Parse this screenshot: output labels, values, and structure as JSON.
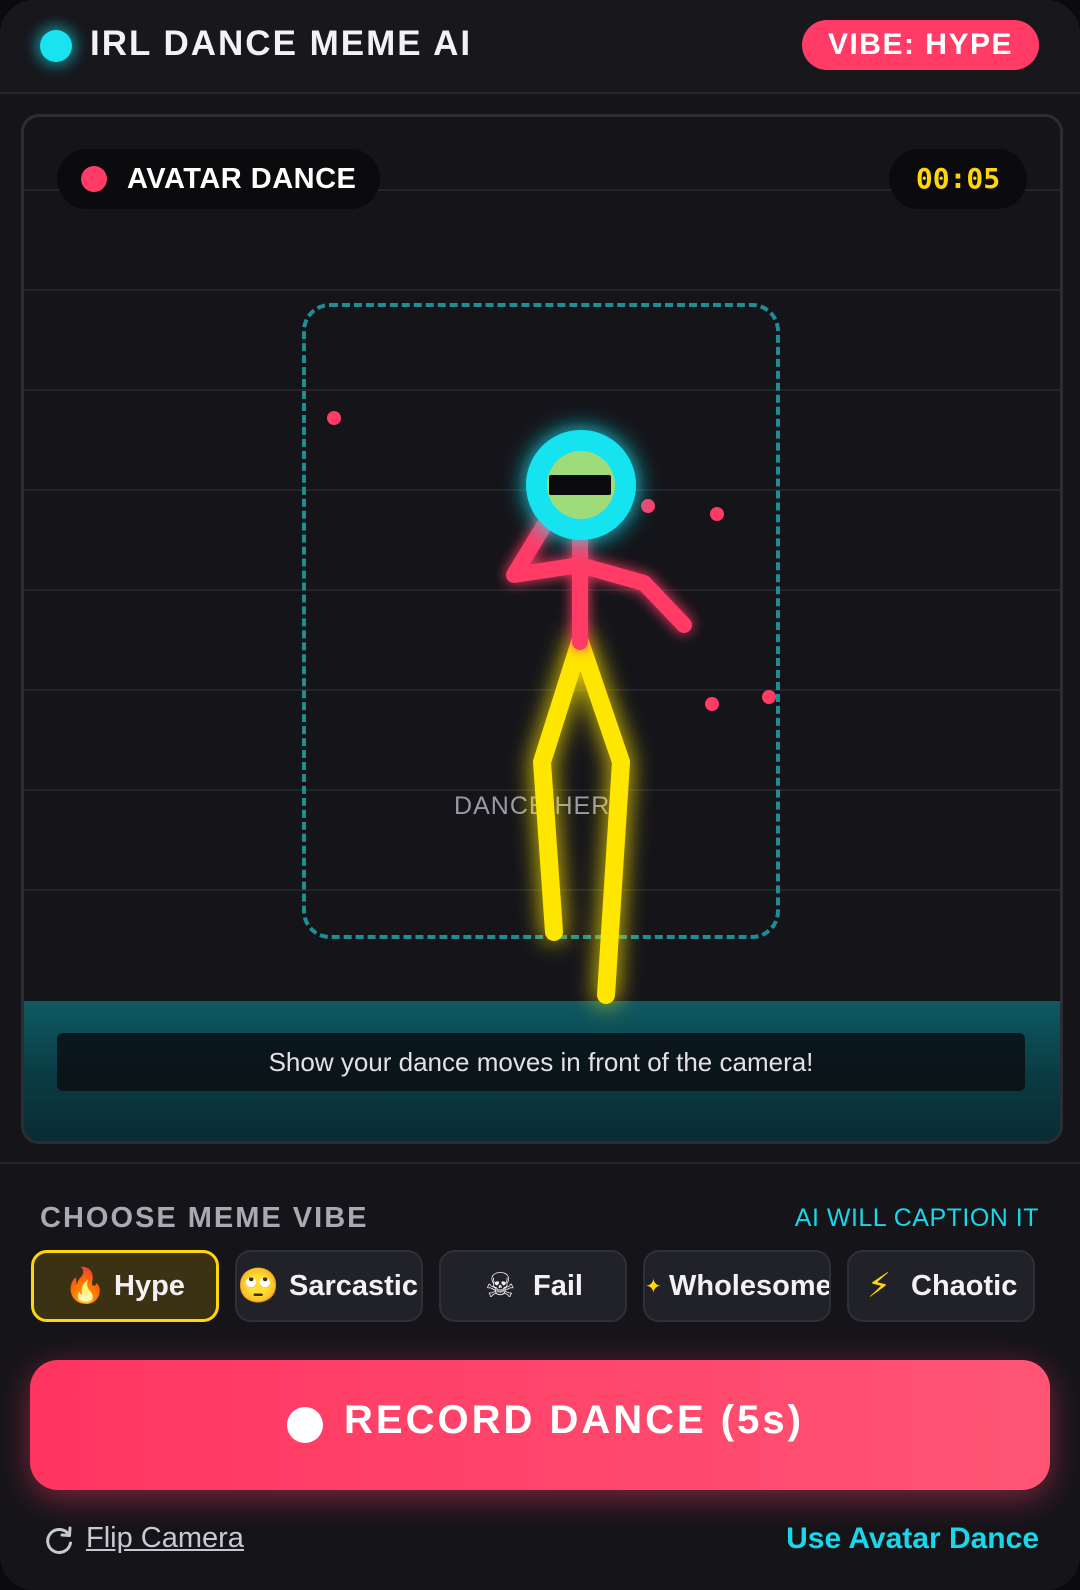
{
  "header": {
    "title": "IRL DANCE MEME AI",
    "vibe_badge": "VIBE: HYPE"
  },
  "camera": {
    "mode_label": "AVATAR DANCE",
    "timer": "00:05",
    "zone_label": "DANCE HERE",
    "instruction": "Show your dance moves in front of the camera!"
  },
  "vibes": {
    "title": "CHOOSE MEME VIBE",
    "note": "AI WILL CAPTION IT",
    "selected": "Hype",
    "options": [
      {
        "label": "Hype",
        "icon": "fire-icon",
        "glyph": "🔥"
      },
      {
        "label": "Sarcastic",
        "icon": "eye-roll-face-icon",
        "glyph": "🙄"
      },
      {
        "label": "Fail",
        "icon": "skull-crossbones-icon",
        "glyph": "☠"
      },
      {
        "label": "Wholesome",
        "icon": "sparkles-icon",
        "glyph": "✦"
      },
      {
        "label": "Chaotic",
        "icon": "lightning-icon",
        "glyph": "⚡"
      }
    ]
  },
  "actions": {
    "record_label": "RECORD DANCE (5s)",
    "flip_label": "Flip Camera",
    "avatar_link": "Use Avatar Dance"
  },
  "colors": {
    "accent_pink": "#ff3b66",
    "accent_cyan": "#19e3f0",
    "accent_yellow": "#ffd60a",
    "background": "#141419"
  }
}
